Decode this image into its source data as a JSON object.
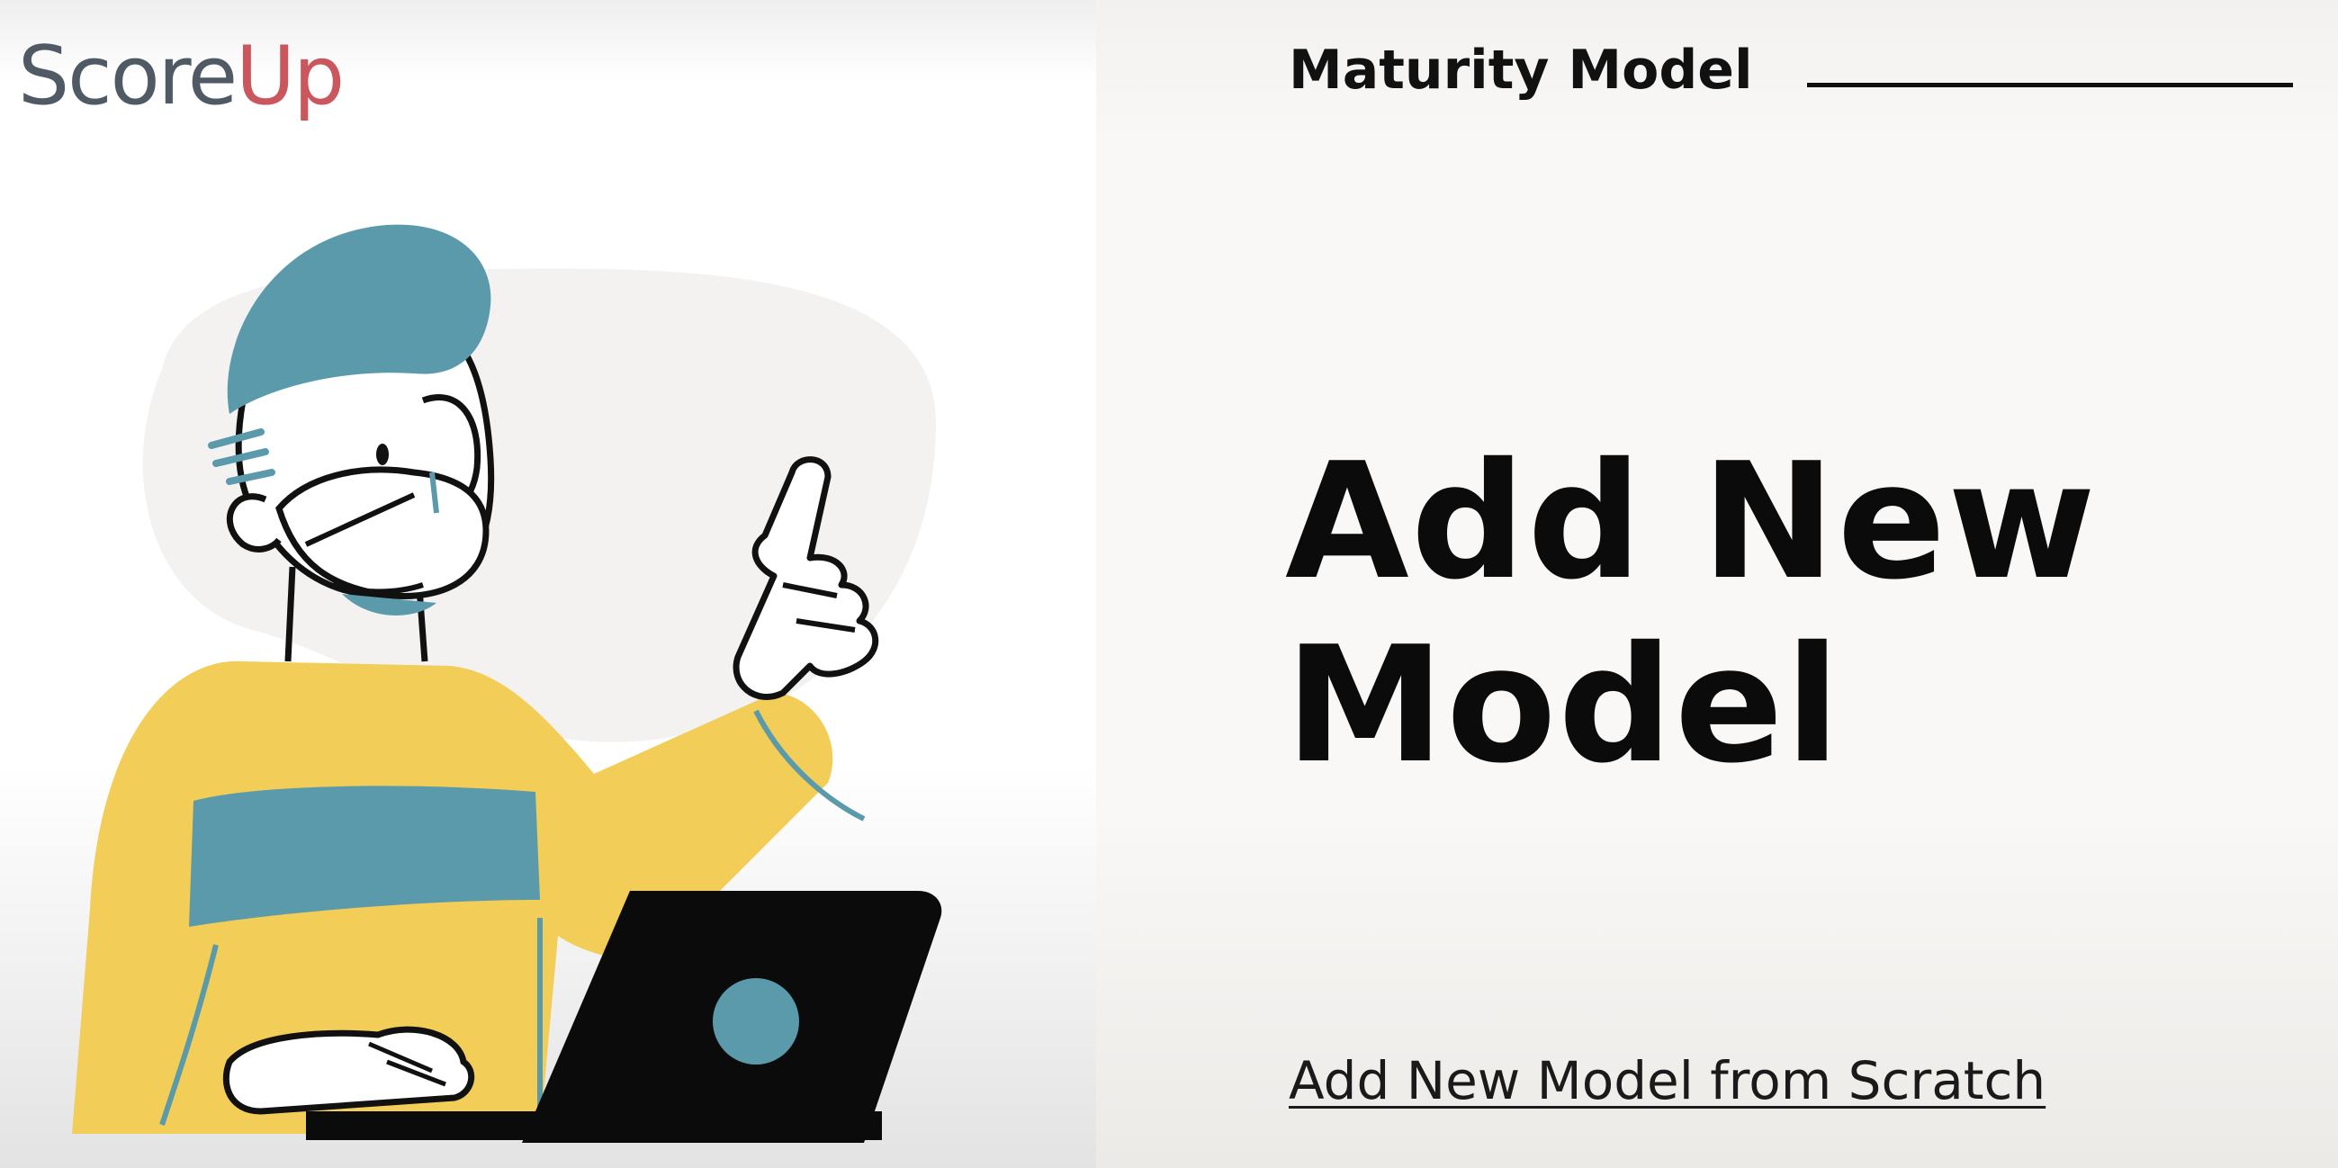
{
  "brand": {
    "logo_part1": "Score",
    "logo_part2": "Up",
    "color_primary": "#4f5a64",
    "color_accent": "#c9575d"
  },
  "header": {
    "section_title": "Maturity Model"
  },
  "main": {
    "heading_line1": "Add New",
    "heading_line2": "Model",
    "subtitle_link": "Add New Model from Scratch"
  },
  "illustration": {
    "icon": "person-at-laptop-pointing-illustration",
    "colors": {
      "teal": "#5a9aab",
      "yellow": "#f2cd57",
      "blob": "#f3f2f1",
      "outline": "#111111"
    }
  }
}
